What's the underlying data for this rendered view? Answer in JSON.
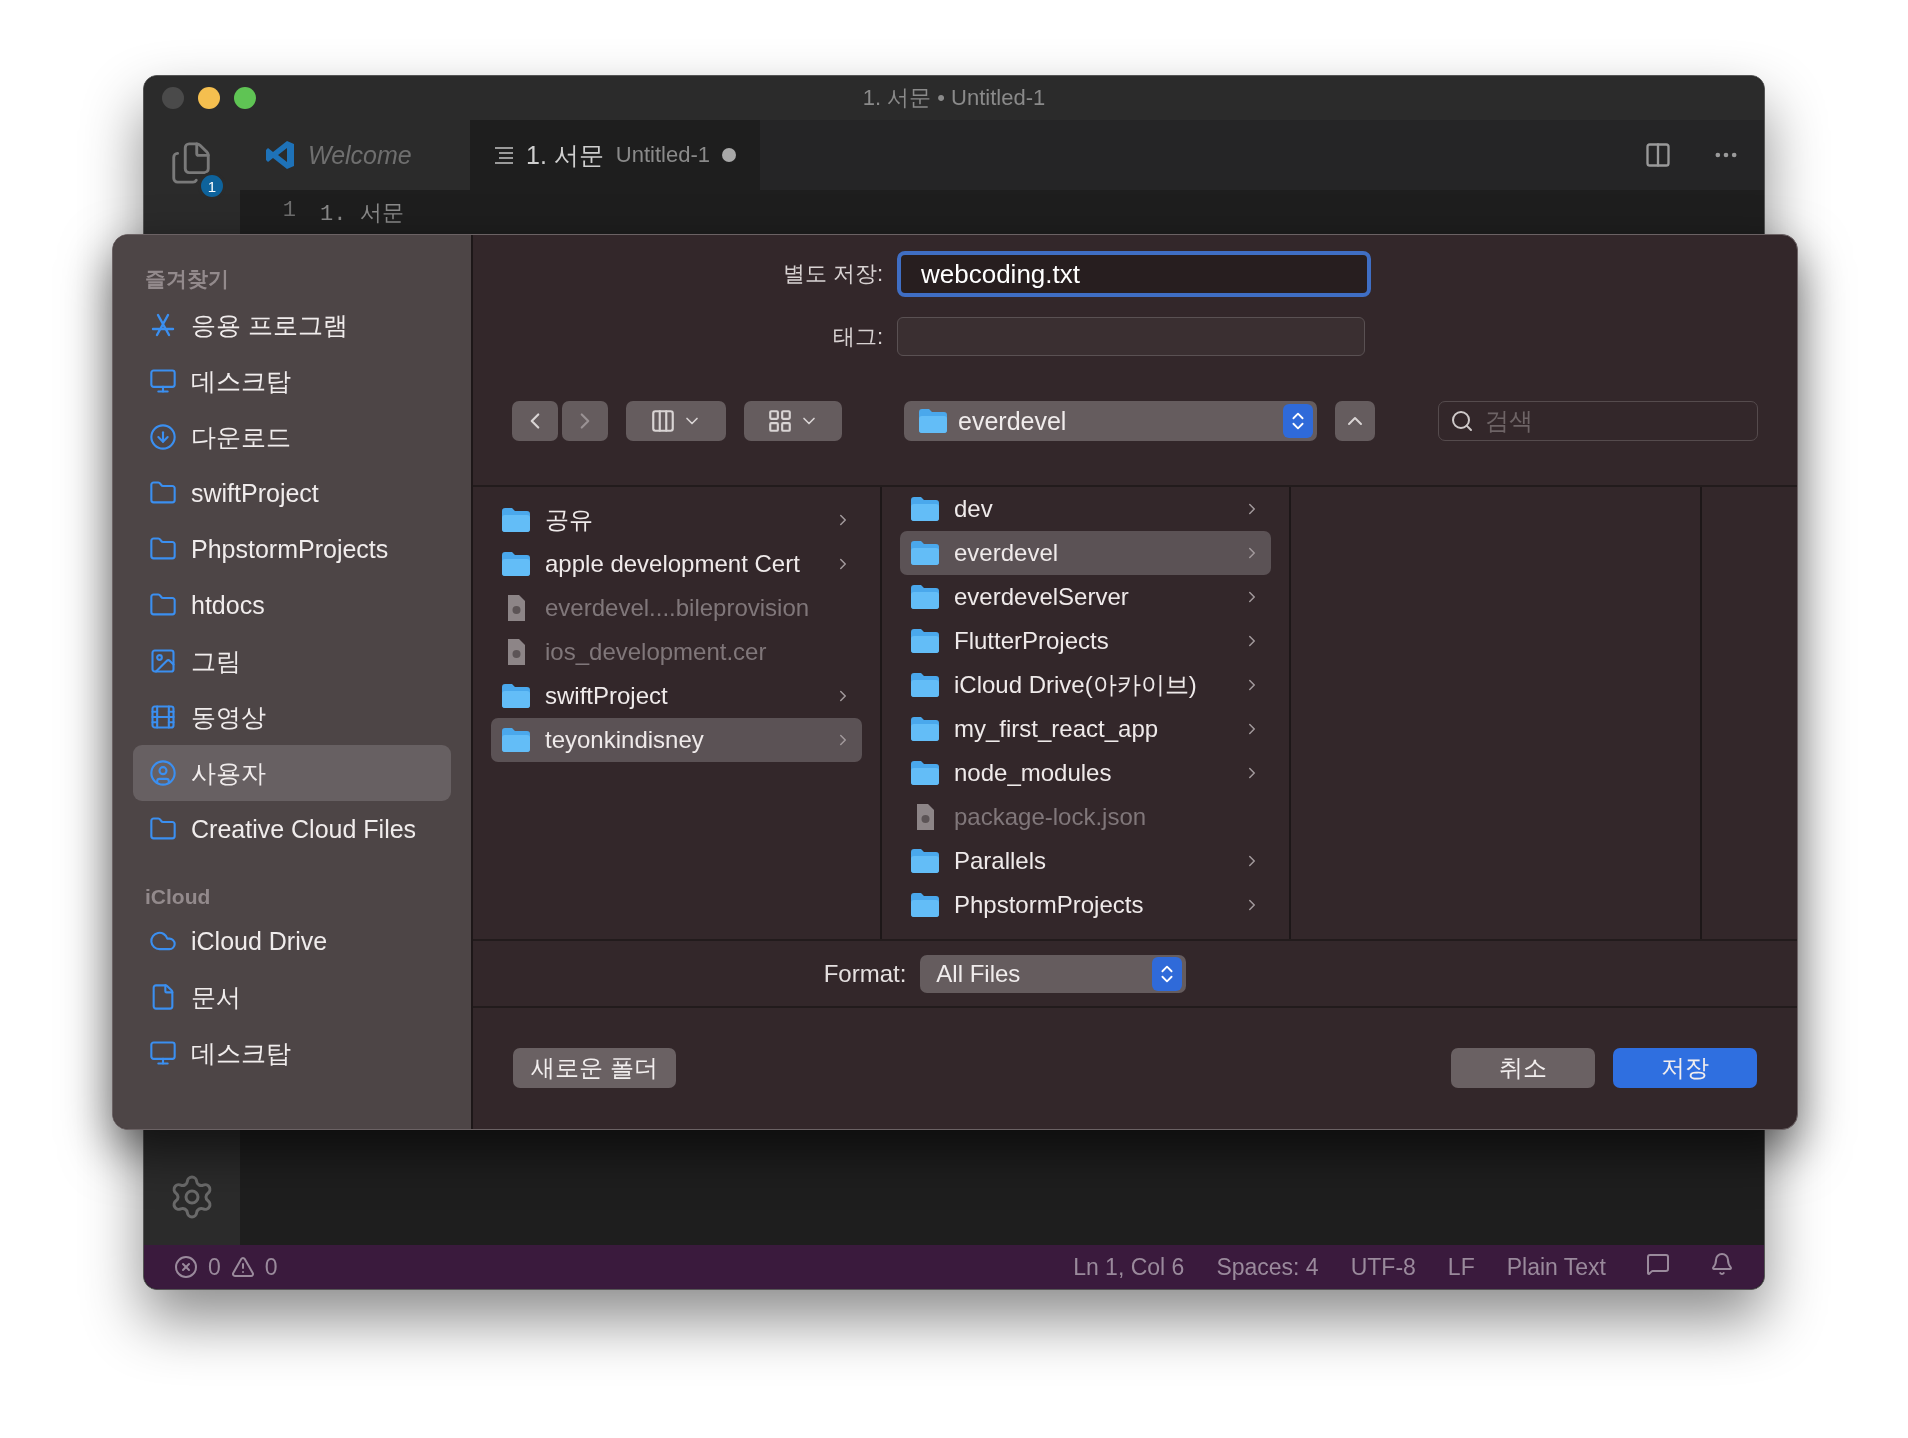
{
  "window": {
    "title": "1. 서문 • Untitled-1",
    "explorer_badge": "1",
    "tabs": [
      {
        "kind": "welcome",
        "label": "Welcome",
        "selected": false
      },
      {
        "kind": "file",
        "label": "1. 서문",
        "description": "Untitled-1",
        "dirty": true,
        "selected": true
      }
    ],
    "editor_lines": [
      {
        "number": "1",
        "text": "1. 서문"
      }
    ]
  },
  "dialog": {
    "sidebar": [
      {
        "title": "즐겨찾기",
        "items": [
          {
            "label": "응용 프로그램",
            "kind": "apps",
            "selected": false
          },
          {
            "label": "데스크탑",
            "kind": "desktop",
            "selected": false
          },
          {
            "label": "다운로드",
            "kind": "download",
            "selected": false
          },
          {
            "label": "swiftProject",
            "kind": "folder",
            "selected": false
          },
          {
            "label": "PhpstormProjects",
            "kind": "folder",
            "selected": false
          },
          {
            "label": "htdocs",
            "kind": "folder",
            "selected": false
          },
          {
            "label": "그림",
            "kind": "picture",
            "selected": false
          },
          {
            "label": "동영상",
            "kind": "movie",
            "selected": false
          },
          {
            "label": "사용자",
            "kind": "user",
            "selected": true
          },
          {
            "label": "Creative Cloud Files",
            "kind": "folder",
            "selected": false
          }
        ]
      },
      {
        "title": "iCloud",
        "items": [
          {
            "label": "iCloud Drive",
            "kind": "cloud",
            "selected": false
          },
          {
            "label": "문서",
            "kind": "document",
            "selected": false
          },
          {
            "label": "데스크탑",
            "kind": "desktop",
            "selected": false
          }
        ]
      }
    ],
    "save_as": {
      "label": "별도 저장:",
      "value": "webcoding.txt"
    },
    "tags": {
      "label": "태그:"
    },
    "location": {
      "label": "everdevel"
    },
    "search": {
      "placeholder": "검색"
    },
    "columns": [
      [
        {
          "name": "공유",
          "kind": "folder",
          "selected": false
        },
        {
          "name": "apple development Cert",
          "kind": "folder",
          "selected": false
        },
        {
          "name": "everdevel....bileprovision",
          "kind": "file",
          "selected": false
        },
        {
          "name": "ios_development.cer",
          "kind": "file",
          "selected": false
        },
        {
          "name": "swiftProject",
          "kind": "folder",
          "selected": false
        },
        {
          "name": "teyonkindisney",
          "kind": "folder",
          "selected": true
        }
      ],
      [
        {
          "name": "dev",
          "kind": "folder",
          "selected": false
        },
        {
          "name": "everdevel",
          "kind": "folder",
          "selected": true
        },
        {
          "name": "everdevelServer",
          "kind": "folder",
          "selected": false
        },
        {
          "name": "FlutterProjects",
          "kind": "folder",
          "selected": false
        },
        {
          "name": "iCloud Drive(아카이브)",
          "kind": "folder",
          "selected": false
        },
        {
          "name": "my_first_react_app",
          "kind": "folder",
          "selected": false
        },
        {
          "name": "node_modules",
          "kind": "folder",
          "selected": false
        },
        {
          "name": "package-lock.json",
          "kind": "file",
          "selected": false
        },
        {
          "name": "Parallels",
          "kind": "folder",
          "selected": false
        },
        {
          "name": "PhpstormProjects",
          "kind": "folder",
          "selected": false
        }
      ]
    ],
    "format": {
      "label": "Format:",
      "value": "All Files"
    },
    "new_folder_button": "새로운 폴더",
    "cancel_button": "취소",
    "save_button": "저장"
  },
  "status_bar": {
    "errors": "0",
    "warnings": "0",
    "items": [
      "Ln 1, Col 6",
      "Spaces: 4",
      "UTF-8",
      "LF",
      "Plain Text"
    ]
  }
}
